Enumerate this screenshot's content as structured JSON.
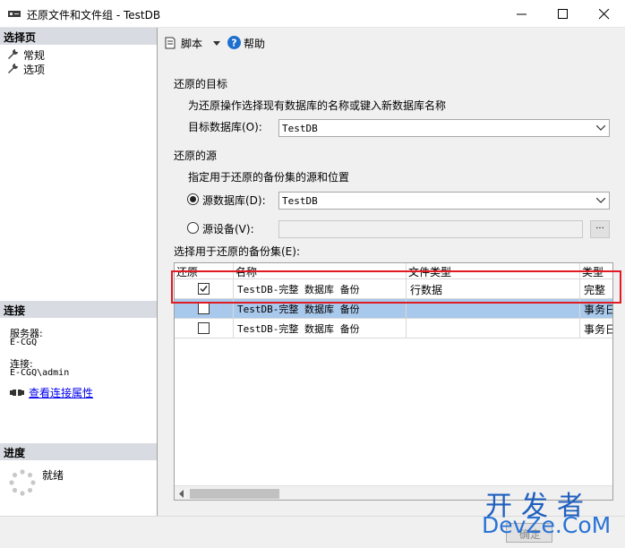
{
  "window": {
    "title": "还原文件和文件组 - TestDB",
    "icon": "server-icon",
    "controls": [
      "minimize-icon",
      "maximize-icon",
      "close-icon"
    ]
  },
  "left_panel": {
    "select_page": {
      "header": "选择页",
      "items": [
        {
          "label": "常规",
          "icon": "wrench-icon"
        },
        {
          "label": "选项",
          "icon": "wrench-icon"
        }
      ]
    },
    "connection": {
      "header": "连接",
      "server_label": "服务器:",
      "server_value": "E-CGQ",
      "connection_label": "连接:",
      "connection_value": "E-CGQ\\admin",
      "view_link": "查看连接属性"
    },
    "progress": {
      "header": "进度",
      "status": "就绪"
    }
  },
  "toolbar": {
    "script_label": "脚本",
    "help_label": "帮助"
  },
  "restore_target": {
    "heading": "还原的目标",
    "instruction": "为还原操作选择现有数据库的名称或键入新数据库名称",
    "target_db_label": "目标数据库(O):",
    "target_db_value": "TestDB"
  },
  "restore_source": {
    "heading": "还原的源",
    "instruction": "指定用于还原的备份集的源和位置",
    "source_db_label": "源数据库(D):",
    "source_db_value": "TestDB",
    "source_device_label": "源设备(V):",
    "browse_label": "..."
  },
  "backup_sets": {
    "label": "选择用于还原的备份集(E):",
    "columns": [
      "还原",
      "名称",
      "文件类型",
      "类型"
    ],
    "rows": [
      {
        "restore": true,
        "name": "TestDB-完整 数据库 备份",
        "file_type": "行数据",
        "type": "完整",
        "selected": false
      },
      {
        "restore": false,
        "name": "TestDB-完整 数据库 备份",
        "file_type": "",
        "type": "事务日",
        "selected": true
      },
      {
        "restore": false,
        "name": "TestDB-完整 数据库 备份",
        "file_type": "",
        "type": "事务日",
        "selected": false
      }
    ]
  },
  "footer": {
    "ok_label": "确定"
  },
  "watermark": {
    "line1": "开发者",
    "line2": "DevZe.CoM"
  },
  "colors": {
    "section_header_bg": "#d8dce2",
    "selected_row_bg": "#a9c9ec",
    "highlight_border": "#e01b24",
    "link": "#0000ee",
    "help_icon": "#1e6fce"
  }
}
